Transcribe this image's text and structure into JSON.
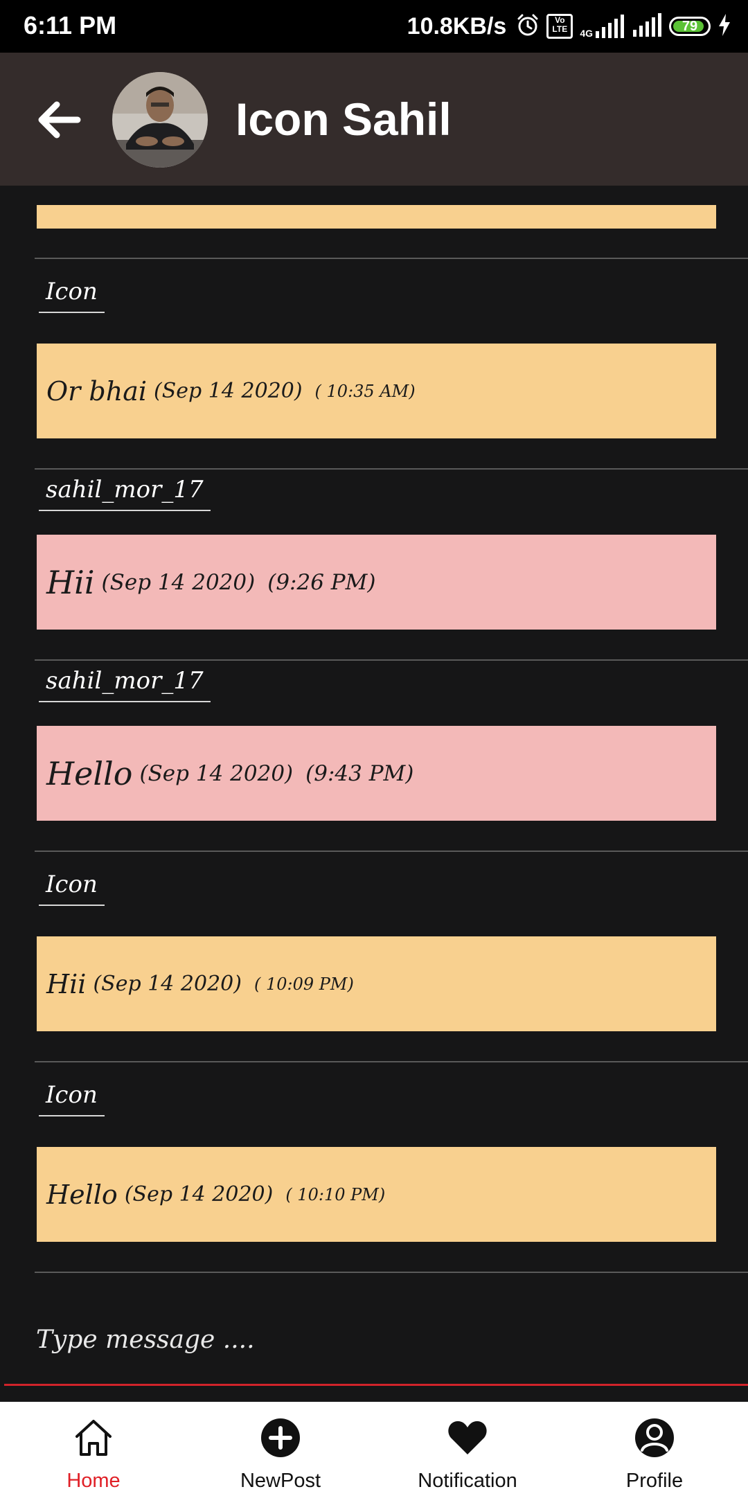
{
  "status_bar": {
    "time": "6:11 PM",
    "network_speed": "10.8KB/s",
    "volte": "Vo LTE",
    "network_type": "4G",
    "battery": "79"
  },
  "header": {
    "title": "Icon Sahil",
    "back_icon": "arrow-left-icon",
    "avatar": "profile-photo"
  },
  "messages": [
    {
      "sender": "Icon",
      "text": "Or bhai",
      "date": "(Sep 14 2020)",
      "time": "( 10:35 AM)",
      "color": "#f8d08f"
    },
    {
      "sender": "sahil_mor_17",
      "text": "Hii",
      "date": "(Sep 14 2020)",
      "time": "(9:26 PM)",
      "color": "#f3b9b8"
    },
    {
      "sender": "sahil_mor_17",
      "text": "Hello",
      "date": "(Sep 14 2020)",
      "time": "(9:43 PM)",
      "color": "#f3b9b8"
    },
    {
      "sender": "Icon",
      "text": "Hii",
      "date": "(Sep 14 2020)",
      "time": "( 10:09 PM)",
      "color": "#f8d08f"
    },
    {
      "sender": "Icon",
      "text": "Hello",
      "date": "(Sep 14 2020)",
      "time": "( 10:10 PM)",
      "color": "#f8d08f"
    }
  ],
  "composer": {
    "placeholder": "Type message ...."
  },
  "bottom_nav": {
    "items": [
      {
        "label": "Home",
        "icon": "home-icon",
        "active": true
      },
      {
        "label": "NewPost",
        "icon": "plus-circle-icon",
        "active": false
      },
      {
        "label": "Notification",
        "icon": "heart-icon",
        "active": false
      },
      {
        "label": "Profile",
        "icon": "user-circle-icon",
        "active": false
      }
    ]
  },
  "colors": {
    "app_bar": "#342c2b",
    "background": "#161617",
    "own_bubble": "#f8d08f",
    "other_bubble": "#f3b9b8",
    "accent": "#e01f26"
  }
}
